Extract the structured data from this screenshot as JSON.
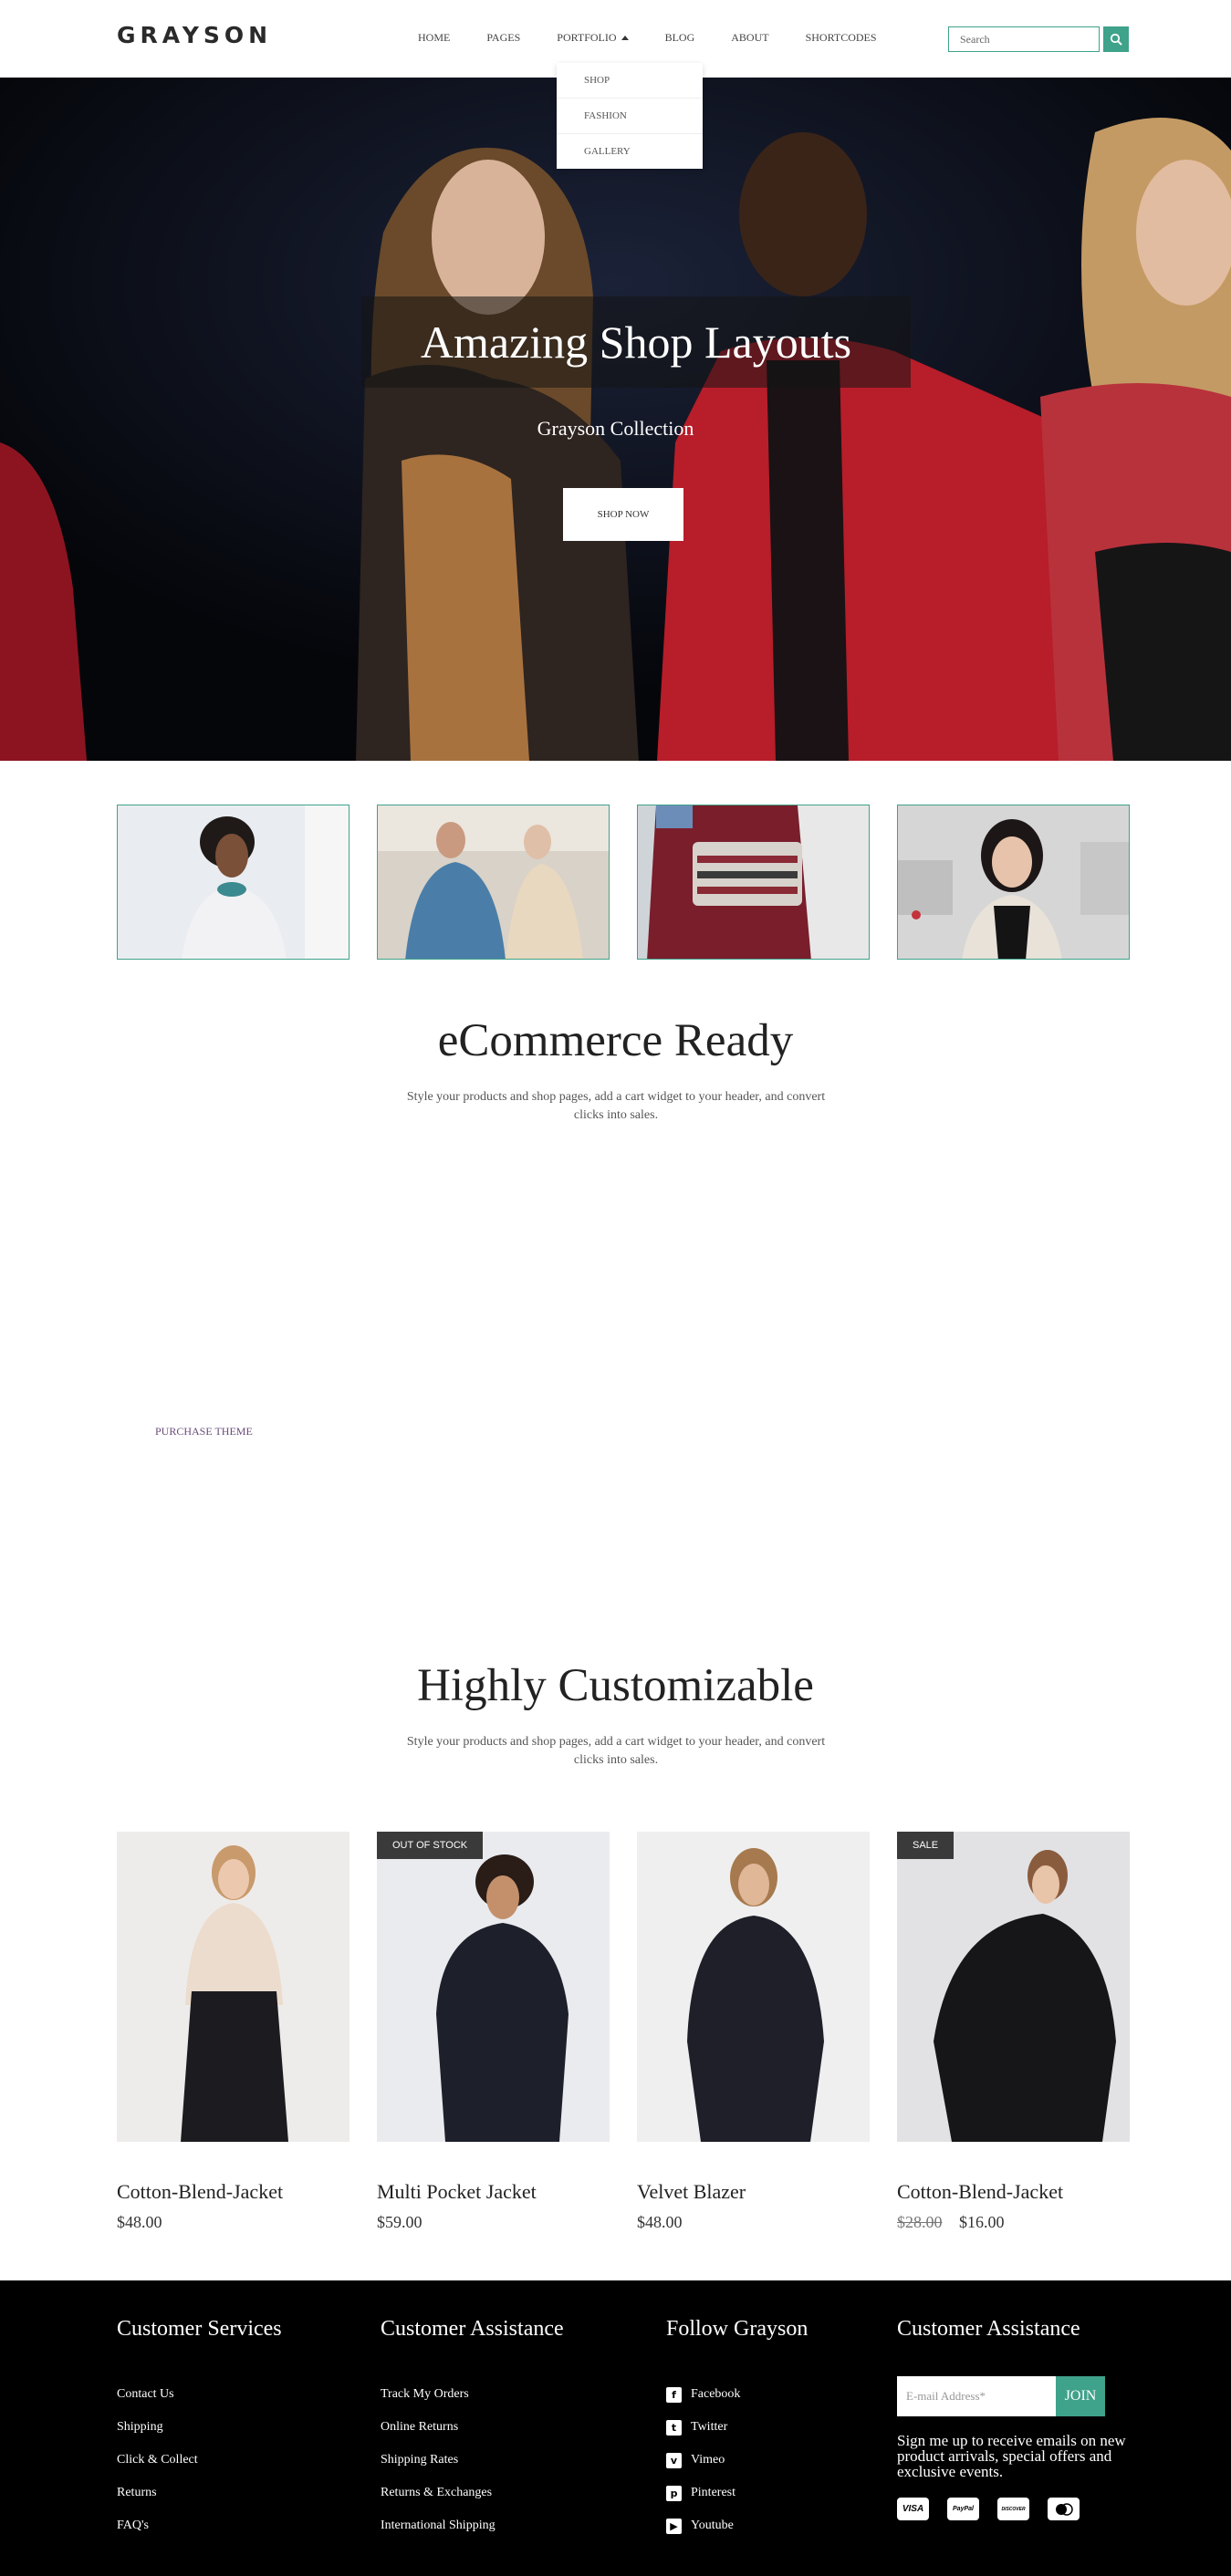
{
  "header": {
    "logo": "GRAYSON",
    "nav": [
      {
        "label": "HOME"
      },
      {
        "label": "PAGES"
      },
      {
        "label": "PORTFOLIO"
      },
      {
        "label": "BLOG"
      },
      {
        "label": "ABOUT"
      },
      {
        "label": "SHORTCODES"
      }
    ],
    "dropdown": [
      "SHOP",
      "FASHION",
      "GALLERY"
    ],
    "search_placeholder": "Search",
    "search_icon": "search-icon",
    "accent": "#3fa28a"
  },
  "hero": {
    "title": "Amazing Shop Layouts",
    "subtitle": "Grayson Collection",
    "button": "SHOP NOW"
  },
  "ecommerce": {
    "title": "eCommerce Ready",
    "text": "Style your products and shop pages, add a cart widget to your header, and convert clicks into sales.",
    "purchase_link": "PURCHASE THEME"
  },
  "customizable": {
    "title": "Highly Customizable",
    "text": "Style your products and shop pages, add a cart widget to your header, and convert clicks into sales."
  },
  "products": [
    {
      "name": "Cotton-Blend-Jacket",
      "price": "$48.00",
      "old_price": "",
      "badge": ""
    },
    {
      "name": "Multi Pocket Jacket",
      "price": "$59.00",
      "old_price": "",
      "badge": "OUT OF STOCK"
    },
    {
      "name": "Velvet Blazer",
      "price": "$48.00",
      "old_price": "",
      "badge": ""
    },
    {
      "name": "Cotton-Blend-Jacket",
      "price": "$16.00",
      "old_price": "$28.00",
      "badge": "SALE"
    }
  ],
  "footer": {
    "col1": {
      "title": "Customer Services",
      "links": [
        "Contact Us",
        "Shipping",
        "Click & Collect",
        "Returns",
        "FAQ's"
      ]
    },
    "col2": {
      "title": "Customer Assistance",
      "links": [
        "Track My Orders",
        "Online Returns",
        "Shipping Rates",
        "Returns & Exchanges",
        "International Shipping"
      ]
    },
    "col3": {
      "title": "Follow Grayson",
      "links": [
        {
          "label": "Facebook",
          "icon": "facebook-icon"
        },
        {
          "label": "Twitter",
          "icon": "twitter-icon"
        },
        {
          "label": "Vimeo",
          "icon": "vimeo-icon"
        },
        {
          "label": "Pinterest",
          "icon": "pinterest-icon"
        },
        {
          "label": "Youtube",
          "icon": "youtube-icon"
        }
      ]
    },
    "col4": {
      "title": "Customer Assistance",
      "email_placeholder": "E-mail Address*",
      "join": "JOIN",
      "text": "Sign me up to receive emails on new product arrivals, special offers and exclusive events.",
      "payments": [
        "VISA",
        "PayPal",
        "DISCOVER",
        "mastercard"
      ]
    }
  }
}
